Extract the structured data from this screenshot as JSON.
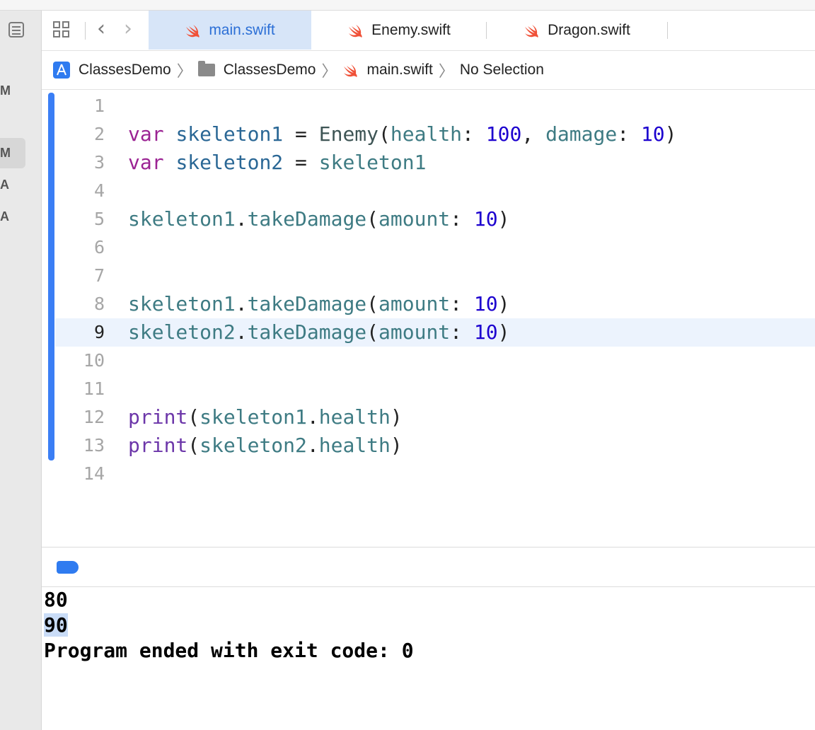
{
  "tabs": [
    {
      "label": "main.swift",
      "active": true
    },
    {
      "label": "Enemy.swift",
      "active": false
    },
    {
      "label": "Dragon.swift",
      "active": false
    }
  ],
  "sidebar": {
    "letters": [
      "M",
      "M",
      "A",
      "A"
    ]
  },
  "breadcrumb": [
    "ClassesDemo",
    "ClassesDemo",
    "main.swift",
    "No Selection"
  ],
  "editor": {
    "current_line": 9,
    "line_numbers": [
      "1",
      "2",
      "3",
      "4",
      "5",
      "6",
      "7",
      "8",
      "9",
      "10",
      "11",
      "12",
      "13",
      "14"
    ],
    "lines": [
      [],
      [
        {
          "t": "var",
          "c": "kw"
        },
        {
          "t": " "
        },
        {
          "t": "skeleton1",
          "c": "decl"
        },
        {
          "t": " = "
        },
        {
          "t": "Enemy",
          "c": "type"
        },
        {
          "t": "(",
          "c": "pl"
        },
        {
          "t": "health",
          "c": "ident"
        },
        {
          "t": ": "
        },
        {
          "t": "100",
          "c": "num"
        },
        {
          "t": ", "
        },
        {
          "t": "damage",
          "c": "ident"
        },
        {
          "t": ": "
        },
        {
          "t": "10",
          "c": "num"
        },
        {
          "t": ")"
        }
      ],
      [
        {
          "t": "var",
          "c": "kw"
        },
        {
          "t": " "
        },
        {
          "t": "skeleton2",
          "c": "decl"
        },
        {
          "t": " = "
        },
        {
          "t": "skeleton1",
          "c": "ident"
        }
      ],
      [],
      [
        {
          "t": "skeleton1",
          "c": "ident"
        },
        {
          "t": "."
        },
        {
          "t": "takeDamage",
          "c": "ident"
        },
        {
          "t": "("
        },
        {
          "t": "amount",
          "c": "ident"
        },
        {
          "t": ": "
        },
        {
          "t": "10",
          "c": "num"
        },
        {
          "t": ")"
        }
      ],
      [],
      [],
      [
        {
          "t": "skeleton1",
          "c": "ident"
        },
        {
          "t": "."
        },
        {
          "t": "takeDamage",
          "c": "ident"
        },
        {
          "t": "("
        },
        {
          "t": "amount",
          "c": "ident"
        },
        {
          "t": ": "
        },
        {
          "t": "10",
          "c": "num"
        },
        {
          "t": ")"
        }
      ],
      [
        {
          "t": "skeleton2",
          "c": "ident"
        },
        {
          "t": "."
        },
        {
          "t": "takeDamage",
          "c": "ident"
        },
        {
          "t": "("
        },
        {
          "t": "amount",
          "c": "ident"
        },
        {
          "t": ": "
        },
        {
          "t": "10",
          "c": "num"
        },
        {
          "t": ")"
        }
      ],
      [],
      [],
      [
        {
          "t": "print",
          "c": "fn"
        },
        {
          "t": "("
        },
        {
          "t": "skeleton1",
          "c": "ident"
        },
        {
          "t": "."
        },
        {
          "t": "health",
          "c": "ident"
        },
        {
          "t": ")"
        }
      ],
      [
        {
          "t": "print",
          "c": "fn"
        },
        {
          "t": "("
        },
        {
          "t": "skeleton2",
          "c": "ident"
        },
        {
          "t": "."
        },
        {
          "t": "health",
          "c": "ident"
        },
        {
          "t": ")"
        }
      ],
      []
    ]
  },
  "console": {
    "lines": [
      "80",
      "90",
      "Program ended with exit code: 0"
    ]
  },
  "colors": {
    "accent": "#2f7bf0",
    "swift_orange": "#f05138",
    "active_tab_bg": "#d7e5f8"
  }
}
